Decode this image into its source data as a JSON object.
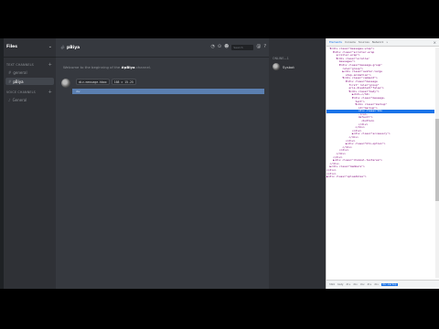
{
  "server": {
    "name": "Files",
    "chevron_icon": "chevron-down-icon"
  },
  "sidebar": {
    "categories": [
      {
        "label": "Text Channels",
        "plus": "+"
      },
      {
        "label": "Voice Channels",
        "plus": "+"
      }
    ],
    "channels": [
      {
        "label": "general",
        "active": false
      },
      {
        "label": "pBiya",
        "active": true
      }
    ],
    "voice_channels": [
      {
        "label": "General"
      }
    ]
  },
  "chat": {
    "channel": "pBiya",
    "search_placeholder": "Search",
    "welcome_prefix": "Welcome to the beginning of the",
    "welcome_channel": "#pBiya",
    "welcome_suffix": "channel.",
    "toolbar": [
      "div.message-hbox",
      "168 × 15.25"
    ],
    "highlight_text": "div"
  },
  "members": {
    "category": "Online—1",
    "items": [
      {
        "name": "Sysbot"
      }
    ]
  },
  "devtools": {
    "tabs": [
      "Elements",
      "Console",
      "Sources",
      "Network",
      "»"
    ],
    "active_tab": "Elements",
    "close": "×",
    "lines": [
      "  ▼<div class=\"messages-wrap\">",
      "    ▼<div class=\"scroller-wrap",
      "      scroller-wrap\">",
      "      ▼<div class=\"scroller",
      "        messages\">",
      "        ▼<div class=\"message-group\"",
      "          role=\"group\">",
      "          ▶<div class=\"avatar-large",
      "            stop-animation\">",
      "          ▼<div class=\"comment\">",
      "            ▼<div class=\"message",
      "              first\" role=\"group\"",
      "              aria-disabled=\"false\">",
      "              ▼<div class=\"body\">",
      "                ▶<h2>…</h2>",
      "                ▼<div class=\"message-",
      "                  text\">",
      "                  ▼<div class=\"markup\"",
      "                    id=\"markup\">",
      "                    <div class=\"btn",
      "                    -icon-",
      "                    default\">",
      "                      <button>",
      "                    </div>",
      "                  </div>",
      "                </div>",
      "                ▶<div class=\"accessory\">",
      "              </div>",
      "            </div>",
      "            ▶<div class=\"btn-option\">",
      "          </div>",
      "        </div>",
      "      </div>",
      "    </div>",
      "    ▶<div class=\"channel-textarea\">",
      "  </div>",
      "  ▶<div class=\"members\">",
      "</div>",
      "</div>",
      "▶<div class=\"uploadArea\">"
    ],
    "selected_line": 19,
    "breadcrumbs": [
      "html",
      "body",
      "div",
      "div",
      "div",
      "div",
      "div",
      "div.markup"
    ],
    "scroll_position": 0.48
  }
}
